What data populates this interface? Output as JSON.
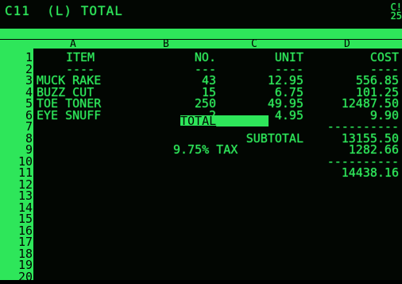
{
  "status": {
    "cell_ref": "C11  (L) TOTAL",
    "mem_top": "C!",
    "mem_bottom": "25"
  },
  "columns": [
    "A",
    "B",
    "C",
    "D"
  ],
  "rows": [
    "1",
    "2",
    "3",
    "4",
    "5",
    "6",
    "7",
    "8",
    "9",
    "10",
    "11",
    "12",
    "13",
    "14",
    "15",
    "16",
    "17",
    "18",
    "19",
    "20"
  ],
  "cells": {
    "r1": {
      "A": "ITEM",
      "B": "NO.",
      "C": "UNIT",
      "D": "COST"
    },
    "r2": {
      "A": "----",
      "B": "---",
      "C": "----",
      "D": "----"
    },
    "r3": {
      "A": "MUCK RAKE",
      "B": "43",
      "C": "12.95",
      "D": "556.85"
    },
    "r4": {
      "A": "BUZZ CUT",
      "B": "15",
      "C": "6.75",
      "D": "101.25"
    },
    "r5": {
      "A": "TOE TONER",
      "B": "250",
      "C": "49.95",
      "D": "12487.50"
    },
    "r6": {
      "A": "EYE SNUFF",
      "B": "2",
      "C": "4.95",
      "D": "9.90"
    },
    "r7": {
      "D": "----------"
    },
    "r8": {
      "C": "SUBTOTAL",
      "D": "13155.50"
    },
    "r9": {
      "BC": "9.75% TAX",
      "D": "1282.66"
    },
    "r10": {
      "D": "----------"
    },
    "r11": {
      "C": "TOTAL",
      "D": "14438.16"
    }
  },
  "selected_cell": "C11"
}
